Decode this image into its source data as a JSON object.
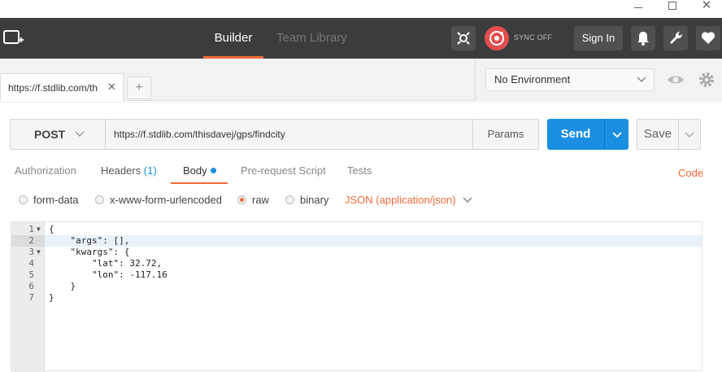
{
  "window": {
    "minimize": "—",
    "maximize": "☐",
    "close": "✕"
  },
  "header": {
    "nav": [
      {
        "label": "Builder",
        "active": true
      },
      {
        "label": "Team Library",
        "active": false
      }
    ],
    "sync_label": "SYNC OFF",
    "signin_label": "Sign In",
    "accent": "#f26b3a"
  },
  "tabs": {
    "request_tab_label": "https://f.stdlib.com/th",
    "close": "✕",
    "add": "+"
  },
  "environment": {
    "selected": "No Environment"
  },
  "request": {
    "method": "POST",
    "url": "https://f.stdlib.com/thisdavej/gps/findcity",
    "params_label": "Params",
    "send_label": "Send",
    "save_label": "Save",
    "send_color": "#1a8ee1"
  },
  "subtabs": {
    "authorization": "Authorization",
    "headers": "Headers",
    "headers_count": "(1)",
    "body": "Body",
    "pre_request": "Pre-request Script",
    "tests": "Tests",
    "code": "Code"
  },
  "body_options": {
    "form_data": "form-data",
    "urlencoded": "x-www-form-urlencoded",
    "raw": "raw",
    "binary": "binary",
    "selected": "raw",
    "content_type": "JSON (application/json)"
  },
  "editor": {
    "lines": [
      {
        "num": "1",
        "text": "{"
      },
      {
        "num": "2",
        "text": "    \"args\": [],",
        "current": true
      },
      {
        "num": "3",
        "text": "    \"kwargs\": {"
      },
      {
        "num": "4",
        "text": "        \"lat\": 32.72,"
      },
      {
        "num": "5",
        "text": "        \"lon\": -117.16"
      },
      {
        "num": "6",
        "text": "    }"
      },
      {
        "num": "7",
        "text": "}"
      }
    ]
  }
}
